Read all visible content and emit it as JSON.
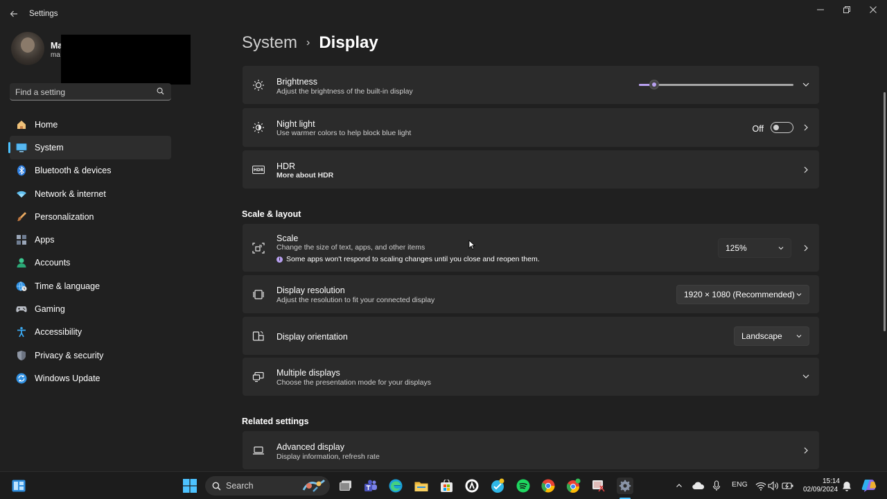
{
  "window": {
    "title": "Settings",
    "back_icon": "back-arrow-icon",
    "controls": [
      "minimize-icon",
      "restore-icon",
      "close-icon"
    ]
  },
  "profile": {
    "name": "Ma",
    "email": "ma"
  },
  "search": {
    "placeholder": "Find a setting"
  },
  "sidebar": {
    "items": [
      {
        "label": "Home",
        "icon": "home-icon",
        "active": false
      },
      {
        "label": "System",
        "icon": "system-monitor-icon",
        "active": true
      },
      {
        "label": "Bluetooth & devices",
        "icon": "bluetooth-icon",
        "active": false
      },
      {
        "label": "Network & internet",
        "icon": "wifi-icon",
        "active": false
      },
      {
        "label": "Personalization",
        "icon": "brush-icon",
        "active": false
      },
      {
        "label": "Apps",
        "icon": "apps-icon",
        "active": false
      },
      {
        "label": "Accounts",
        "icon": "account-icon",
        "active": false
      },
      {
        "label": "Time & language",
        "icon": "globe-clock-icon",
        "active": false
      },
      {
        "label": "Gaming",
        "icon": "gamepad-icon",
        "active": false
      },
      {
        "label": "Accessibility",
        "icon": "accessibility-icon",
        "active": false
      },
      {
        "label": "Privacy & security",
        "icon": "shield-icon",
        "active": false
      },
      {
        "label": "Windows Update",
        "icon": "update-icon",
        "active": false
      }
    ]
  },
  "breadcrumb": {
    "parent": "System",
    "separator": "›",
    "current": "Display"
  },
  "brightness": {
    "title": "Brightness",
    "subtitle": "Adjust the brightness of the built-in display",
    "value_fraction": 0.1
  },
  "night_light": {
    "title": "Night light",
    "subtitle": "Use warmer colors to help block blue light",
    "state_label": "Off",
    "on": false
  },
  "hdr": {
    "title": "HDR",
    "subtitle": "More about HDR",
    "icon_text": "HDR"
  },
  "scale_layout": {
    "section_title": "Scale & layout",
    "scale": {
      "title": "Scale",
      "subtitle": "Change the size of text, apps, and other items",
      "info": "Some apps won't respond to scaling changes until you close and reopen them.",
      "info_icon_text": "i",
      "value": "125%"
    },
    "resolution": {
      "title": "Display resolution",
      "subtitle": "Adjust the resolution to fit your connected display",
      "value": "1920 × 1080 (Recommended)"
    },
    "orientation": {
      "title": "Display orientation",
      "value": "Landscape"
    },
    "multiple": {
      "title": "Multiple displays",
      "subtitle": "Choose the presentation mode for your displays"
    }
  },
  "related": {
    "section_title": "Related settings",
    "advanced": {
      "title": "Advanced display",
      "subtitle": "Display information, refresh rate"
    }
  },
  "taskbar": {
    "search_label": "Search",
    "tray_language": "ENG",
    "time": "15:14",
    "date": "02/09/2024"
  },
  "colors": {
    "background": "#202020",
    "card": "#2b2b2b",
    "accent": "#4cc2ff",
    "slider_accent": "#b8a0f0"
  }
}
